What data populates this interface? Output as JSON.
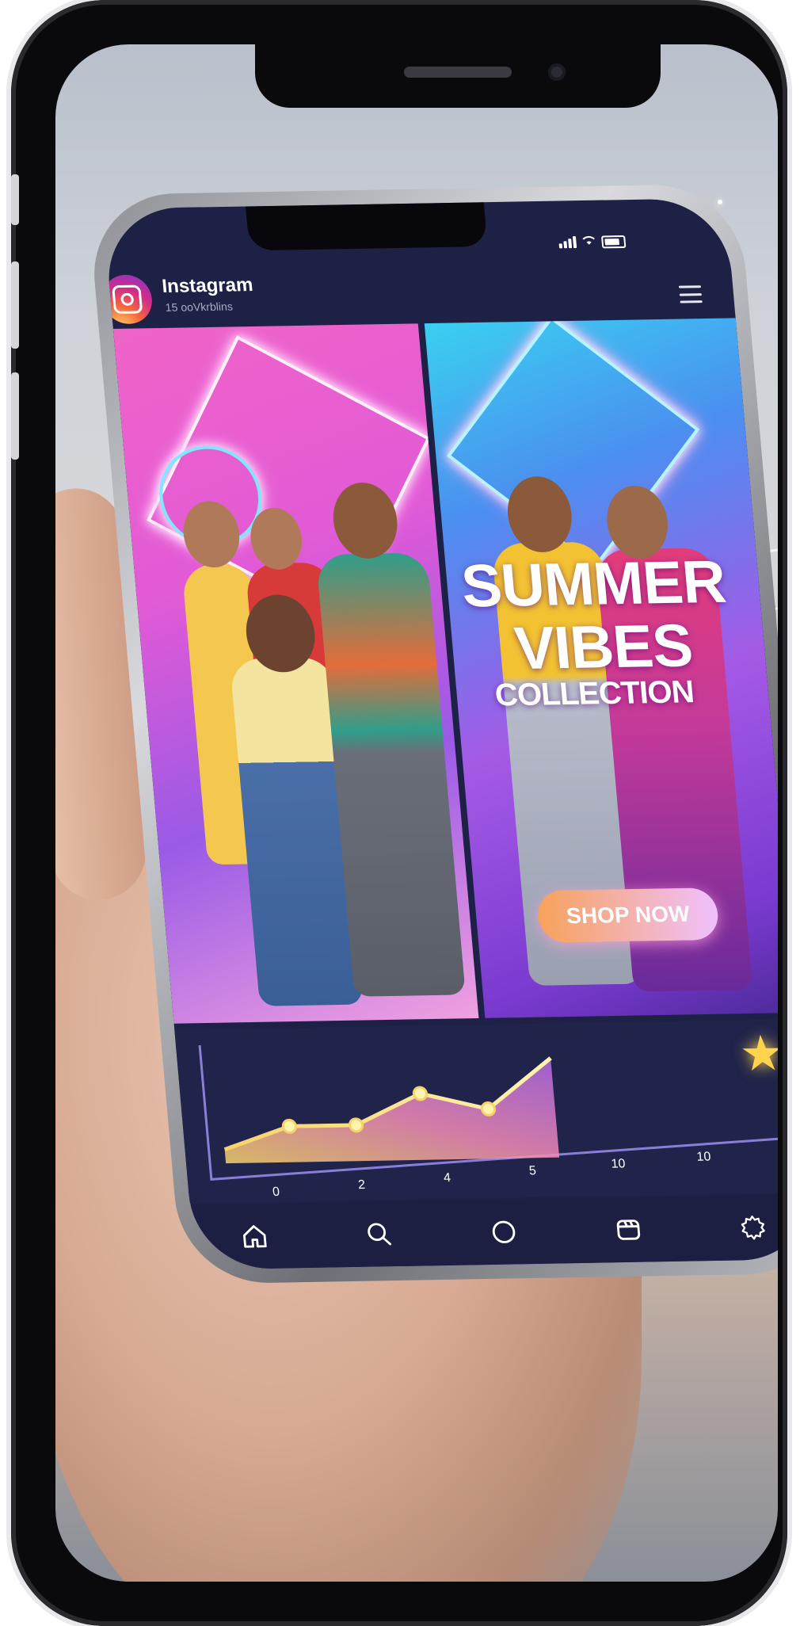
{
  "app": {
    "title": "Instagram",
    "subtitle": "15 ooVkrblins"
  },
  "banner": {
    "headline_line1": "SUMMER",
    "headline_line2": "VIBES",
    "headline_line3": "COLLECTION",
    "cta_label": "SHOP NOW"
  },
  "chart_data": {
    "type": "area",
    "x": [
      "0",
      "2",
      "4",
      "5",
      "10",
      "10",
      "10"
    ],
    "values": [
      1,
      2.6,
      2.6,
      4.8,
      3.6,
      7.2
    ],
    "tick_labels": [
      "0",
      "2",
      "4",
      "5",
      "10",
      "10",
      "10"
    ],
    "grid": false
  },
  "nav": {
    "items": [
      "home-icon",
      "search-icon",
      "circle-icon",
      "reels-icon",
      "settings-icon"
    ]
  },
  "colors": {
    "accent": "#ffd34d",
    "cta_start": "#f7a25a",
    "cta_end": "#f0c0ff",
    "app_bg": "#1e2146"
  }
}
